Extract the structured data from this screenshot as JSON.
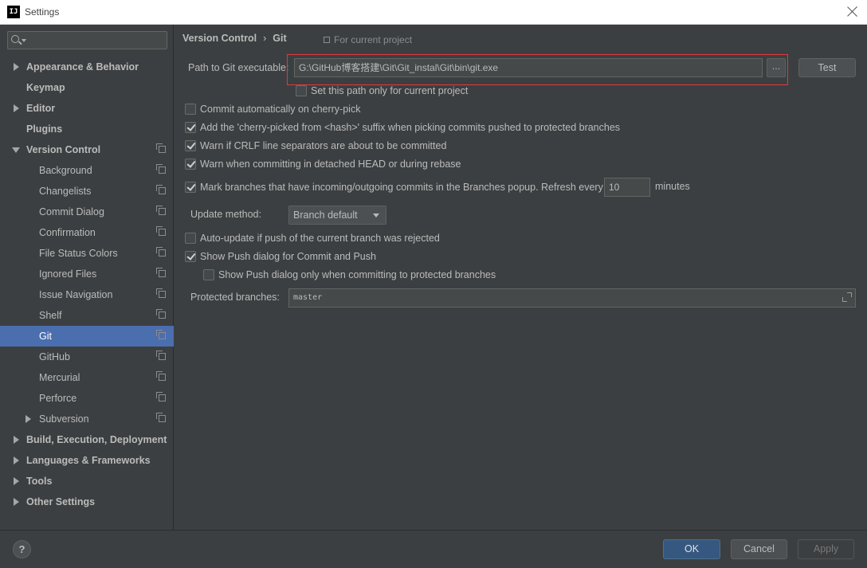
{
  "window": {
    "title": "Settings",
    "logo_text": "IJ"
  },
  "search": {
    "value": "",
    "placeholder": ""
  },
  "sidebar": {
    "items": [
      {
        "label": "Appearance & Behavior"
      },
      {
        "label": "Keymap"
      },
      {
        "label": "Editor"
      },
      {
        "label": "Plugins"
      },
      {
        "label": "Version Control"
      },
      {
        "label": "Background"
      },
      {
        "label": "Changelists"
      },
      {
        "label": "Commit Dialog"
      },
      {
        "label": "Confirmation"
      },
      {
        "label": "File Status Colors"
      },
      {
        "label": "Ignored Files"
      },
      {
        "label": "Issue Navigation"
      },
      {
        "label": "Shelf"
      },
      {
        "label": "Git"
      },
      {
        "label": "GitHub"
      },
      {
        "label": "Mercurial"
      },
      {
        "label": "Perforce"
      },
      {
        "label": "Subversion"
      },
      {
        "label": "Build, Execution, Deployment"
      },
      {
        "label": "Languages & Frameworks"
      },
      {
        "label": "Tools"
      },
      {
        "label": "Other Settings"
      }
    ]
  },
  "header": {
    "breadcrumb_parent": "Version Control",
    "breadcrumb_sep": "›",
    "breadcrumb_current": "Git",
    "scope_label": "For current project"
  },
  "git": {
    "path_label": "Path to Git executable:",
    "path_value": "G:\\GitHub博客搭建\\Git\\Git_instal\\Git\\bin\\git.exe",
    "browse_label": "...",
    "test_label": "Test",
    "set_path_only_label": "Set this path only for current project",
    "options": {
      "cherry_pick": "Commit automatically on cherry-pick",
      "cherry_suffix": "Add the 'cherry-picked from <hash>' suffix when picking commits pushed to protected branches",
      "crlf": "Warn if CRLF line separators are about to be committed",
      "detached": "Warn when committing in detached HEAD or during rebase",
      "mark_branches": "Mark branches that have incoming/outgoing commits in the Branches popup.  Refresh every",
      "auto_update": "Auto-update if push of the current branch was rejected",
      "show_push": "Show Push dialog for Commit and Push",
      "show_push_protected": "Show Push dialog only when committing to protected branches"
    },
    "refresh_value": "10",
    "minutes_label": "minutes",
    "update_method_label": "Update method:",
    "update_method_value": "Branch default",
    "protected_label": "Protected branches:",
    "protected_value": "master"
  },
  "footer": {
    "help_label": "?",
    "ok_label": "OK",
    "cancel_label": "Cancel",
    "apply_label": "Apply"
  },
  "colors": {
    "background": "#3c3f41",
    "selection": "#4b6eaf",
    "highlight_border": "#e03a3a",
    "ok_button": "#365880"
  }
}
